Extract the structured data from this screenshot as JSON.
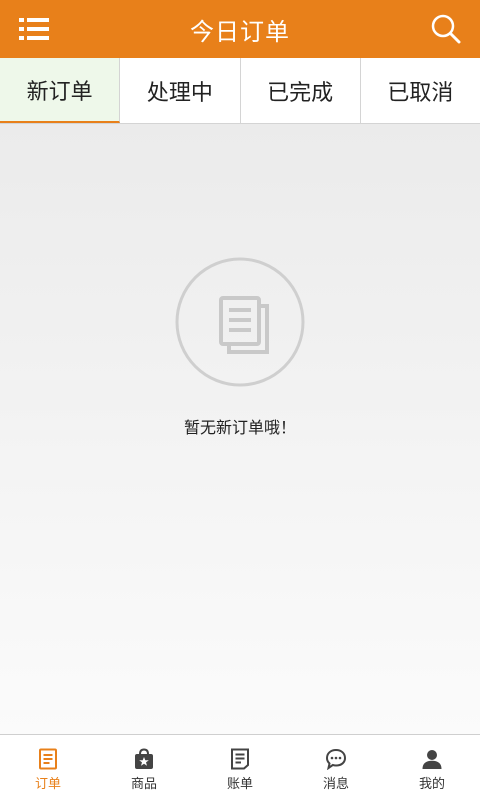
{
  "header": {
    "title": "今日订单",
    "menu_icon": "menu-list-icon",
    "search_icon": "search-icon",
    "bg_color": "#e8801a"
  },
  "tabs": [
    {
      "label": "新订单",
      "active": true
    },
    {
      "label": "处理中",
      "active": false
    },
    {
      "label": "已完成",
      "active": false
    },
    {
      "label": "已取消",
      "active": false
    }
  ],
  "empty_state": {
    "icon": "document-icon",
    "message": "暂无新订单哦！"
  },
  "bottom_nav": {
    "items": [
      {
        "label": "订单",
        "icon": "order-doc-icon",
        "active": true
      },
      {
        "label": "商品",
        "icon": "shop-bag-icon",
        "active": false
      },
      {
        "label": "账单",
        "icon": "bill-icon",
        "active": false
      },
      {
        "label": "消息",
        "icon": "message-bubble-icon",
        "active": false
      },
      {
        "label": "我的",
        "icon": "user-icon",
        "active": false
      }
    ],
    "active_color": "#e8801a"
  }
}
